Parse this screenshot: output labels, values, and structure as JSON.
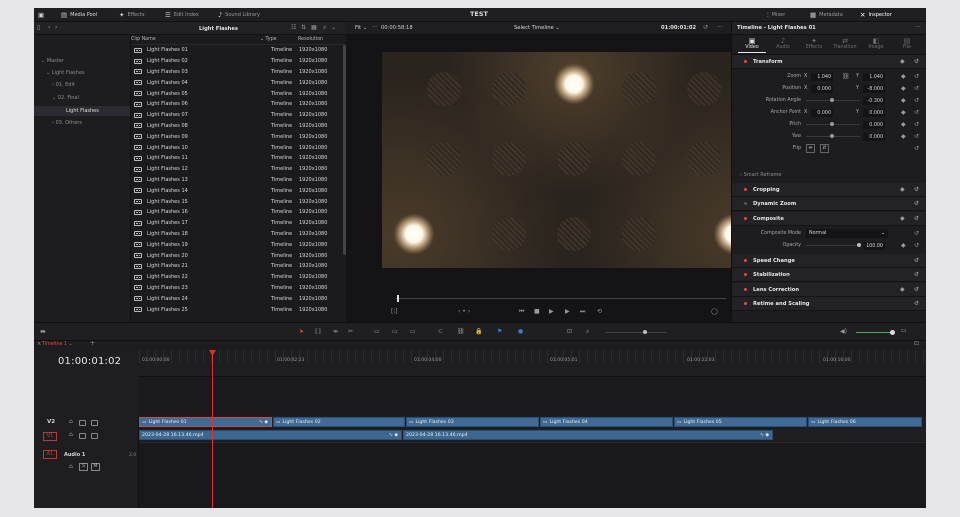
{
  "topbar": {
    "media_pool": "Media Pool",
    "effects": "Effects",
    "edit_index": "Edit Index",
    "sound_library": "Sound Library",
    "project_title": "TEST",
    "mixer": "Mixer",
    "metadata": "Metadata",
    "inspector": "Inspector"
  },
  "media_pool": {
    "current_bin": "Light Flashes",
    "tree": [
      "Master",
      "Light Flashes",
      "01. Edit",
      "02. Final",
      "Light Flashes",
      "03. Others"
    ],
    "columns": {
      "name": "Clip Name",
      "type": "Type",
      "resolution": "Resolution"
    },
    "clips": [
      {
        "name": "Light Flashes 01",
        "type": "Timeline",
        "resolution": "1920x1080"
      },
      {
        "name": "Light Flashes 02",
        "type": "Timeline",
        "resolution": "1920x1080"
      },
      {
        "name": "Light Flashes 03",
        "type": "Timeline",
        "resolution": "1920x1080"
      },
      {
        "name": "Light Flashes 04",
        "type": "Timeline",
        "resolution": "1920x1080"
      },
      {
        "name": "Light Flashes 05",
        "type": "Timeline",
        "resolution": "1920x1080"
      },
      {
        "name": "Light Flashes 06",
        "type": "Timeline",
        "resolution": "1920x1080"
      },
      {
        "name": "Light Flashes 07",
        "type": "Timeline",
        "resolution": "1920x1080"
      },
      {
        "name": "Light Flashes 08",
        "type": "Timeline",
        "resolution": "1920x1080"
      },
      {
        "name": "Light Flashes 09",
        "type": "Timeline",
        "resolution": "1920x1080"
      },
      {
        "name": "Light Flashes 10",
        "type": "Timeline",
        "resolution": "1920x1080"
      },
      {
        "name": "Light Flashes 11",
        "type": "Timeline",
        "resolution": "1920x1080"
      },
      {
        "name": "Light Flashes 12",
        "type": "Timeline",
        "resolution": "1920x1080"
      },
      {
        "name": "Light Flashes 13",
        "type": "Timeline",
        "resolution": "1920x1080"
      },
      {
        "name": "Light Flashes 14",
        "type": "Timeline",
        "resolution": "1920x1080"
      },
      {
        "name": "Light Flashes 15",
        "type": "Timeline",
        "resolution": "1920x1080"
      },
      {
        "name": "Light Flashes 16",
        "type": "Timeline",
        "resolution": "1920x1080"
      },
      {
        "name": "Light Flashes 17",
        "type": "Timeline",
        "resolution": "1920x1080"
      },
      {
        "name": "Light Flashes 18",
        "type": "Timeline",
        "resolution": "1920x1080"
      },
      {
        "name": "Light Flashes 19",
        "type": "Timeline",
        "resolution": "1920x1080"
      },
      {
        "name": "Light Flashes 20",
        "type": "Timeline",
        "resolution": "1920x1080"
      },
      {
        "name": "Light Flashes 21",
        "type": "Timeline",
        "resolution": "1920x1080"
      },
      {
        "name": "Light Flashes 22",
        "type": "Timeline",
        "resolution": "1920x1080"
      },
      {
        "name": "Light Flashes 23",
        "type": "Timeline",
        "resolution": "1920x1080"
      },
      {
        "name": "Light Flashes 24",
        "type": "Timeline",
        "resolution": "1920x1080"
      },
      {
        "name": "Light Flashes 25",
        "type": "Timeline",
        "resolution": "1920x1080"
      }
    ]
  },
  "viewer": {
    "zoom": "Fit",
    "duration": "00:00:58:18",
    "timeline_select": "Select Timeline",
    "timecode": "01:00:01:02"
  },
  "inspector": {
    "title": "Timeline - Light Flashes 01",
    "tabs": [
      "Video",
      "Audio",
      "Effects",
      "Transition",
      "Image",
      "File"
    ],
    "transform": {
      "label": "Transform",
      "zoom_label": "Zoom",
      "zoom_x": "1.040",
      "zoom_y": "1.040",
      "position_label": "Position",
      "position_x": "0.000",
      "position_y": "-8.000",
      "rotation_label": "Rotation Angle",
      "rotation": "-0.300",
      "anchor_label": "Anchor Point",
      "anchor_x": "0.000",
      "anchor_y": "0.000",
      "pitch_label": "Pitch",
      "pitch": "0.000",
      "yaw_label": "Yaw",
      "yaw": "0.000",
      "flip_label": "Flip"
    },
    "smart_reframe": "Smart Reframe",
    "cropping": "Cropping",
    "dynamic_zoom": "Dynamic Zoom",
    "composite": {
      "label": "Composite",
      "mode_label": "Composite Mode",
      "mode": "Normal",
      "opacity_label": "Opacity",
      "opacity": "100.00"
    },
    "speed_change": "Speed Change",
    "stabilization": "Stabilization",
    "lens_correction": "Lens Correction",
    "retime": "Retime and Scaling"
  },
  "timeline": {
    "tab": "Timeline 1",
    "timecode": "01:00:01:02",
    "ruler": [
      "01:00:00:00",
      "01:00:02:23",
      "01:00:04:00",
      "01:00:05:01",
      "01:00:22:03",
      "01:00:16:00"
    ],
    "tracks": {
      "v2": "V2",
      "v1": "V1",
      "a1": "A1",
      "audio_name": "Audio 1",
      "audio_level": "2.0",
      "solo": "S",
      "mute": "M"
    },
    "v2_clips": [
      "Light Flashes 01",
      "Light Flashes 02",
      "Light Flashes 03",
      "Light Flashes 04",
      "Light Flashes 05",
      "Light Flashes 06"
    ],
    "v1_clips": [
      "2023-04-28 16.13.46.mp4",
      "2023-04-28 16.13.46.mp4"
    ]
  },
  "colors": {
    "accent": "#e64b3c",
    "clip": "#3f6b96",
    "playhead": "#e0302a"
  }
}
